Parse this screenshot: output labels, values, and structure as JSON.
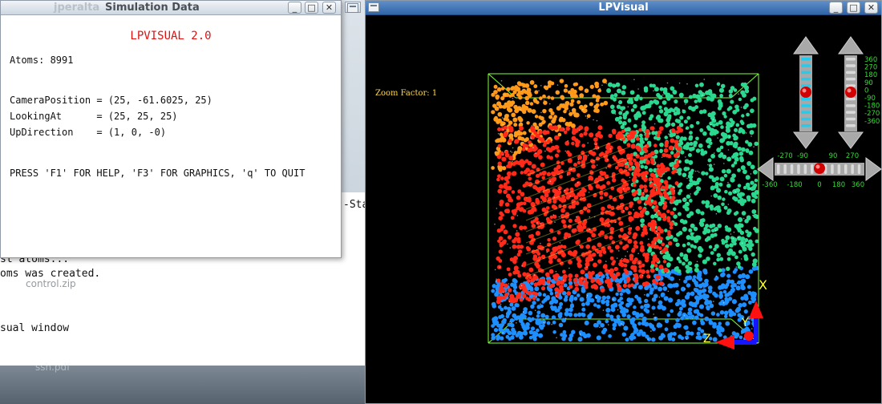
{
  "simulation_window": {
    "title": "Simulation Data",
    "ghost_title": "jperalta",
    "heading": "LPVISUAL 2.0",
    "atoms": "Atoms: 8991",
    "camera_position": "CameraPosition = (25, -61.6025, 25)",
    "looking_at": "LookingAt      = (25, 25, 25)",
    "up_direction": "UpDirection    = (1, 0, -0)",
    "help": "PRESS 'F1' FOR HELP, 'F3' FOR GRAPHICS, 'q' TO QUIT"
  },
  "terminal": {
    "line1": "-Sta",
    "line2": "st atoms...",
    "line3": "oms was created.",
    "line4": "sual window"
  },
  "desktop": {
    "icon1_label": "control.zip",
    "icon2_label": "ssh.pdf"
  },
  "lpvisual_window": {
    "title": "LPVisual",
    "zoom_label": "Zoom Factor: 1",
    "axis_x": "X",
    "axis_y": "Y",
    "axis_z": "Z",
    "slider_labels": [
      "360",
      "270",
      "180",
      "90",
      "0",
      "-90",
      "-180",
      "-270",
      "-360"
    ],
    "horizontal_labels_top": [
      "-270",
      "-90",
      "90",
      "270"
    ],
    "horizontal_labels_bottom": [
      "-360",
      "-180",
      "0",
      "180",
      "360"
    ],
    "vertical_slider_1_value": 0,
    "vertical_slider_2_value": 0,
    "horizontal_slider_value": 0
  },
  "colors": {
    "box_outline": "#7cff3a",
    "atoms_orange": "#ff9a1a",
    "atoms_red": "#ff2a1a",
    "atoms_green": "#2bd88f",
    "atoms_blue": "#1e8fff",
    "slider_label": "#33dd33",
    "slider_cyan": "#22ccee",
    "heading_red": "#dd1111"
  }
}
